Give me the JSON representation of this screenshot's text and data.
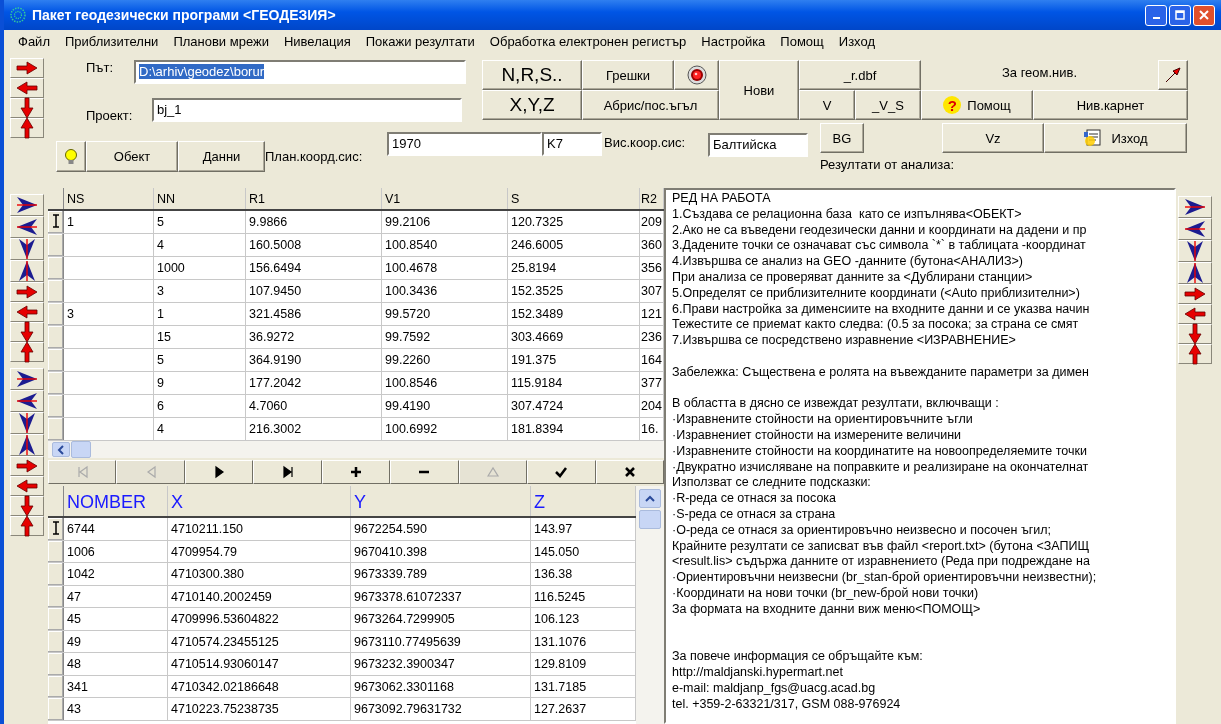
{
  "window": {
    "title": "Пакет геодезически програми <ГЕОДЕЗИЯ>"
  },
  "menu": [
    "Файл",
    "Приблизителни",
    "Планови мрежи",
    "Нивелация",
    "Покажи резултати",
    "Обработка електронен регистър",
    "Настройка",
    "Помощ",
    "Изход"
  ],
  "path": {
    "label": "Път:",
    "value": "D:\\arhiv\\geodez\\borur",
    "text_selected": true
  },
  "project": {
    "label": "Проект:",
    "value": "bj_1"
  },
  "object_button": "Обект",
  "data_button": "Данни",
  "plan_system": {
    "label": "План.коорд.сис:",
    "value": "1970",
    "zone": "K7"
  },
  "height_system": {
    "label": "Вис.коор.сис:",
    "value": "Балтийска"
  },
  "buttons": {
    "nrs": "N,R,S..",
    "xyz": "X,Y,Z",
    "errors": "Грешки",
    "sketch": "Абрис/пос.ъгъл",
    "new": "Нови",
    "r_dbf": "_r.dbf",
    "v": "V",
    "v_s": "_V_S",
    "help": "Помощ",
    "help_icon": "?",
    "level_book": "Нив.карнет",
    "bg": "BG",
    "vz": "Vz",
    "exit": "Изход"
  },
  "leveling_label": "За геом.нив.",
  "results_label": "Резултати от анализа:",
  "upper_table": {
    "columns": [
      "NS",
      "NN",
      "R1",
      "V1",
      "S",
      "R2"
    ],
    "rows": [
      {
        "selected": true,
        "cells": [
          "1",
          "5",
          "9.9866",
          "99.2106",
          "120.7325",
          "209"
        ]
      },
      {
        "selected": false,
        "cells": [
          null,
          "4",
          "160.5008",
          "100.8540",
          "246.6005",
          "360"
        ]
      },
      {
        "selected": false,
        "cells": [
          null,
          "1000",
          "156.6494",
          "100.4678",
          "25.8194",
          "356"
        ]
      },
      {
        "selected": false,
        "cells": [
          null,
          "3",
          "107.9450",
          "100.3436",
          "152.3525",
          "307"
        ]
      },
      {
        "selected": false,
        "cells": [
          "3",
          "1",
          "321.4586",
          "99.5720",
          "152.3489",
          "121"
        ]
      },
      {
        "selected": false,
        "cells": [
          null,
          "15",
          "36.9272",
          "99.7592",
          "303.4669",
          "236"
        ]
      },
      {
        "selected": false,
        "cells": [
          null,
          "5",
          "364.9190",
          "99.2260",
          "191.375",
          "164"
        ]
      },
      {
        "selected": false,
        "cells": [
          null,
          "9",
          "177.2042",
          "100.8546",
          "115.9184",
          "377"
        ]
      },
      {
        "selected": false,
        "cells": [
          null,
          "6",
          "4.7060",
          "99.4190",
          "307.4724",
          "204"
        ]
      },
      {
        "selected": false,
        "cells": [
          null,
          "4",
          "216.3002",
          "100.6992",
          "181.8394",
          "16."
        ]
      }
    ]
  },
  "nav_buttons": [
    {
      "kind": "first",
      "disabled": true
    },
    {
      "kind": "prior",
      "disabled": true
    },
    {
      "kind": "next",
      "disabled": false
    },
    {
      "kind": "last",
      "disabled": false
    },
    {
      "kind": "insert",
      "disabled": false
    },
    {
      "kind": "delete",
      "disabled": false
    },
    {
      "kind": "edit",
      "disabled": true
    },
    {
      "kind": "post",
      "disabled": false
    },
    {
      "kind": "cancel",
      "disabled": false
    }
  ],
  "lower_table": {
    "columns": [
      "NOMBER",
      "X",
      "Y",
      "Z"
    ],
    "rows": [
      {
        "selected": true,
        "cells": [
          "6744",
          "4710211.150",
          "9672254.590",
          "143.97"
        ]
      },
      {
        "selected": false,
        "cells": [
          "1006",
          "4709954.79",
          "9670410.398",
          "145.050"
        ]
      },
      {
        "selected": false,
        "cells": [
          "1042",
          "4710300.380",
          "9673339.789",
          "136.38"
        ]
      },
      {
        "selected": false,
        "cells": [
          "47",
          "4710140.2002459",
          "9673378.61072337",
          "116.5245"
        ]
      },
      {
        "selected": false,
        "cells": [
          "45",
          "4709996.53604822",
          "9673264.7299905",
          "106.123"
        ]
      },
      {
        "selected": false,
        "cells": [
          "49",
          "4710574.23455125",
          "9673110.77495639",
          "131.1076"
        ]
      },
      {
        "selected": false,
        "cells": [
          "48",
          "4710514.93060147",
          "9673232.3900347",
          "129.8109"
        ]
      },
      {
        "selected": false,
        "cells": [
          "341",
          "4710342.02186648",
          "9673062.3301168",
          "131.7185"
        ]
      },
      {
        "selected": false,
        "cells": [
          "43",
          "4710223.75238735",
          "9673092.79631732",
          "127.2637"
        ]
      }
    ]
  },
  "notes": [
    {
      "kind": "section",
      "lines": [
        "РЕД НА РАБОТА",
        "1.Създава се релационна база  като се изпълнява<ОБЕКТ>",
        "2.Ако не са въведени геодезически данни и координати на дадени и пр",
        "3.Дадените точки се означават със символа `*` в таблицата -координат",
        "4.Извършва се анализ на GEO -данните (бутона<АНАЛИЗ>)",
        "При анализа се проверяват данните за <Дублирани станции>",
        "5.Определят се приблизителните координати (<Auto приблизителни>)",
        "6.Прави настройка за димeнсиите на входните данни и се указва начин",
        "Тежестите се приемат както следва: (0.5 за посока; за страна се смят",
        "7.Извършва се посредствено изравнение <ИЗРАВНЕНИЕ>"
      ]
    },
    {
      "kind": "section",
      "lines": [
        "Забележка: Съществена е ролята на въвежданите параметри за димен"
      ]
    },
    {
      "kind": "section",
      "lines": [
        "В областта в дясно се извеждат резултати, включващи :",
        "·Изравнените стойности на ориентировъчните ъгли",
        "·Изравнениет стойности на измерените величини",
        "·Изравнените стойности на координатите на новоопределяемите точки",
        "·Двукратно изчисляване на поправките и реализиране на окончателнат",
        "Използват се следните подсказки:",
        "·R-реда се отнася за посока",
        "·S-реда се отнася за страна",
        "·O-реда се отнася за ориентировъчно неизвесно и посочен ъгил;",
        "Крайните резултати се записват във файл <report.txt> (бутона <ЗАПИЩ",
        "<result.lis> съдържа данните от изравнението (Реда при подреждане на",
        "·Ориентировъчни неизвесни (br_stan-брой ориентировъчни неизвестни);",
        "·Координати на нови точки (br_new-брой нови точки)",
        "За формата на входните данни виж меню<ПОМОЩ>"
      ]
    },
    {
      "kind": "contact",
      "lines": [
        "За повече информация се обръщайте към:",
        "http://maldjanski.hypermart.net",
        "e-mail: maldjanp_fgs@uacg.acad.bg",
        "tel. +359-2-63321/317, GSM 088-976924"
      ]
    }
  ]
}
